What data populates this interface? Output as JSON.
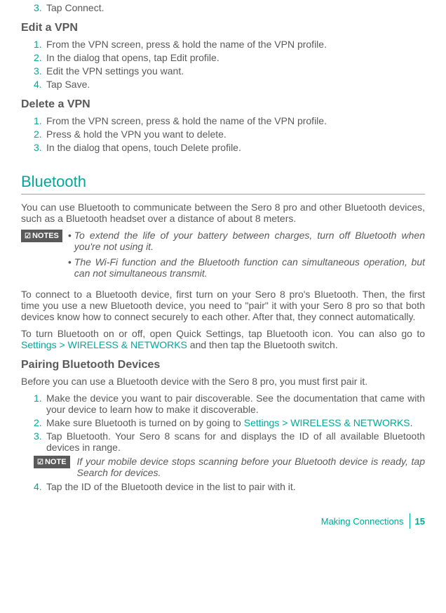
{
  "step3": {
    "num": "3.",
    "text": "Tap Connect."
  },
  "editVpn": {
    "title": "Edit a VPN",
    "steps": [
      {
        "num": "1.",
        "text": "From the VPN screen, press & hold the name of the VPN profile."
      },
      {
        "num": "2.",
        "text": "In the dialog that opens, tap Edit profile."
      },
      {
        "num": "3.",
        "text": "Edit the VPN settings you want."
      },
      {
        "num": "4.",
        "text": "Tap Save."
      }
    ]
  },
  "deleteVpn": {
    "title": "Delete a VPN",
    "steps": [
      {
        "num": "1.",
        "text": "From the VPN screen, press & hold the name of the VPN profile."
      },
      {
        "num": "2.",
        "text": "Press & hold the VPN you want to delete."
      },
      {
        "num": "3.",
        "text": "In the dialog that opens, touch Delete profile."
      }
    ]
  },
  "bluetooth": {
    "title": "Bluetooth",
    "intro": "You can use Bluetooth to communicate between the Sero 8 pro and other Bluetooth devices, such as a Bluetooth headset over a distance of about 8 meters.",
    "notesLabel": "NOTES",
    "notes": [
      "To extend the life of your battery between charges, turn off Bluetooth when you're not using it.",
      "The Wi-Fi function and the Bluetooth function can simultaneous operation, but can not simultaneous transmit."
    ],
    "connect": "To connect to a Bluetooth device, first turn on your Sero 8 pro's Bluetooth. Then, the first time you use a new Bluetooth device, you need to \"pair\" it with your Sero 8 pro so that both devices know how to connect securely to each other. After that, they connect automatically.",
    "turnOn_a": "To turn Bluetooth on or off, open Quick Settings, tap Bluetooth icon. You can also go to ",
    "turnOn_link": "Settings > WIRELESS & NETWORKS",
    "turnOn_b": " and then tap the Bluetooth switch.",
    "pairing": {
      "title": "Pairing Bluetooth Devices",
      "intro": "Before you can use a Bluetooth device with the Sero 8 pro, you must first pair it.",
      "steps": [
        {
          "num": "1.",
          "text": "Make the device you want to pair discoverable. See the documentation that came with your device to learn how to make it discoverable."
        },
        {
          "num": "2.",
          "text_a": "Make sure Bluetooth is turned on by going to ",
          "link": "Settings > WIRELESS & NETWORKS",
          "text_b": "."
        },
        {
          "num": "3.",
          "text": "Tap Bluetooth. Your Sero 8 scans for and displays the ID of all available Bluetooth devices in range."
        },
        {
          "num": "4.",
          "text": "Tap the ID of the Bluetooth device in the list to pair with it."
        }
      ],
      "noteLabel": "NOTE",
      "noteText": "If your mobile device stops scanning before your Bluetooth device is ready, tap Search for devices."
    }
  },
  "footer": {
    "section": "Making Connections",
    "page": "15"
  }
}
